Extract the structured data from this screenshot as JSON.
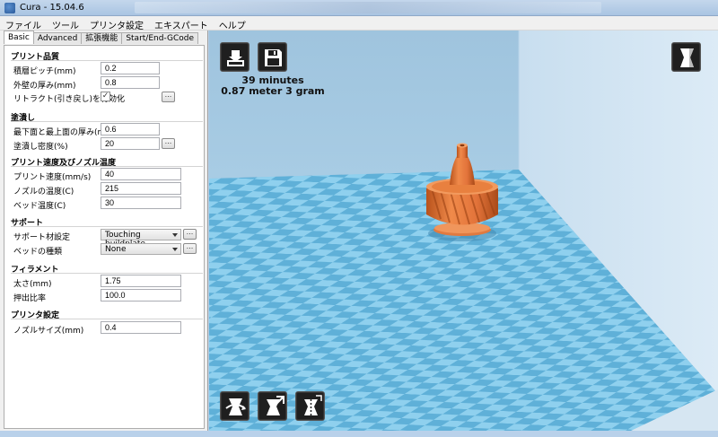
{
  "window": {
    "title": "Cura - 15.04.6"
  },
  "menu": [
    "ファイル",
    "ツール",
    "プリンタ設定",
    "エキスパート",
    "ヘルプ"
  ],
  "tabs": [
    "Basic",
    "Advanced",
    "拡張機能",
    "Start/End-GCode"
  ],
  "sections": {
    "quality": {
      "title": "プリント品質",
      "layer_height_label": "積層ピッチ(mm)",
      "layer_height": "0.2",
      "shell_label": "外壁の厚み(mm)",
      "shell": "0.8",
      "retraction_label": "リトラクト(引き戻し)を有効化",
      "retraction_check": "✓"
    },
    "fill": {
      "title": "塗潰し",
      "bottom_top_label": "最下面と最上面の厚み(mm)",
      "bottom_top": "0.6",
      "density_label": "塗潰し密度(%)",
      "density": "20"
    },
    "speed": {
      "title": "プリント速度及びノズル温度",
      "print_speed_label": "プリント速度(mm/s)",
      "print_speed": "40",
      "nozzle_temp_label": "ノズルの温度(C)",
      "nozzle_temp": "215",
      "bed_temp_label": "ベッド温度(C)",
      "bed_temp": "30"
    },
    "support": {
      "title": "サポート",
      "support_type_label": "サポート材設定",
      "support_type": "Touching buildplate",
      "adhesion_label": "ベッドの種類",
      "adhesion": "None"
    },
    "filament": {
      "title": "フィラメント",
      "diameter_label": "太さ(mm)",
      "diameter": "1.75",
      "flow_label": "押出比率",
      "flow": "100.0"
    },
    "machine": {
      "title": "プリンタ設定",
      "nozzle_size_label": "ノズルサイズ(mm)",
      "nozzle_size": "0.4"
    }
  },
  "buttons": {
    "dots": "..."
  },
  "viewport": {
    "print_time": "39 minutes",
    "material": "0.87 meter 3 gram",
    "floor_light": "#8fd0ee",
    "floor_dark": "#5fb0d8",
    "model_color": "#e8793a",
    "icons": {
      "load": "load-model-icon",
      "save": "save-gcode-icon",
      "view_mode": "view-mode-icon",
      "rotate": "rotate-icon",
      "scale": "scale-icon",
      "mirror": "mirror-icon"
    }
  }
}
